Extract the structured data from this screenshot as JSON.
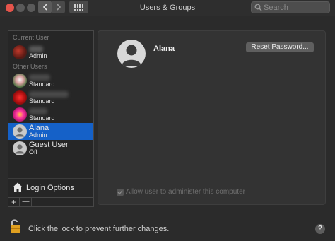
{
  "window": {
    "title": "Users & Groups"
  },
  "toolbar": {
    "search_placeholder": "Search"
  },
  "sidebar": {
    "current_user_label": "Current User",
    "current_user": {
      "role": "Admin"
    },
    "other_users_label": "Other Users",
    "other_users": [
      {
        "name": "",
        "role": "Standard"
      },
      {
        "name": "",
        "role": "Standard"
      },
      {
        "name": "",
        "role": "Standard"
      },
      {
        "name": "Alana",
        "role": "Admin",
        "selected": true
      },
      {
        "name": "Guest User",
        "role": "Off"
      }
    ],
    "login_options_label": "Login Options",
    "add_label": "+",
    "remove_label": "—"
  },
  "panel": {
    "user_name": "Alana",
    "reset_password_label": "Reset Password...",
    "allow_admin_label": "Allow user to administer this computer",
    "allow_admin_checked": true
  },
  "footer": {
    "lock_text": "Click the lock to prevent further changes.",
    "help_label": "?"
  },
  "colors": {
    "selection": "#1561c8",
    "close_button": "#e5544b"
  }
}
